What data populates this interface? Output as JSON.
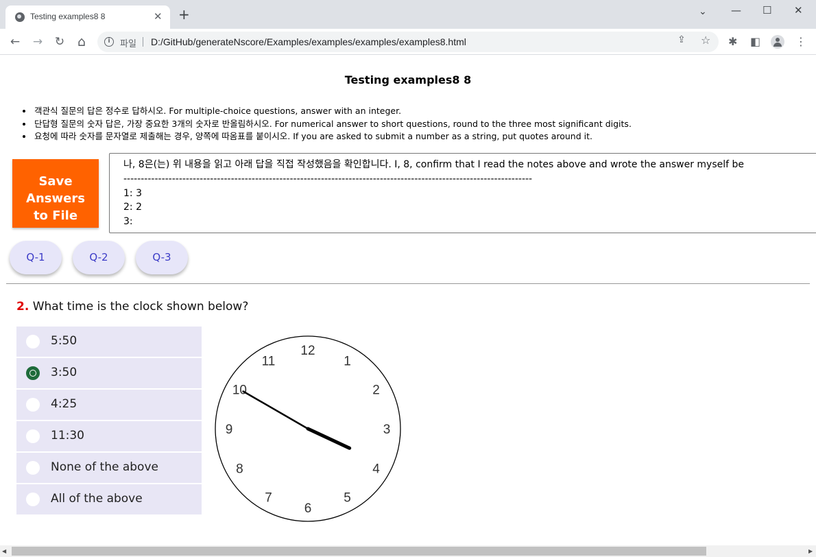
{
  "browser": {
    "tab_title": "Testing examples8 8",
    "tab_close": "✕",
    "new_tab": "+",
    "window_controls": {
      "minimize": "—",
      "maximize": "☐",
      "close": "✕"
    },
    "nav": {
      "back": "←",
      "forward": "→",
      "reload": "↻",
      "home": "⌂"
    },
    "info_glyph": "i",
    "scheme_label": "파일",
    "url": "D:/GitHub/generateNscore/Examples/examples/examples/examples8.html",
    "share_glyph": "⇪",
    "star_glyph": "☆",
    "extensions_glyph": "✱",
    "sidepanel_glyph": "◧",
    "menu_glyph": "⋮"
  },
  "page": {
    "title": "Testing examples8 8",
    "rules": [
      "객관식 질문의 답은 정수로 답하시오. For multiple-choice questions, answer with an integer.",
      "단답형 질문의 숫자 답은, 가장 중요한 3개의 숫자로 반올림하시오. For numerical answer to short questions, round to the three most significant digits.",
      "요청에 따라 숫자를 문자열로 제출해는 경우, 양쪽에 따옴표를 붙이시오. If you are asked to submit a number as a string, put quotes around it."
    ],
    "save_button": {
      "line1": "Save",
      "line2": "Answers",
      "line3": "to File",
      "color": "#ff6200"
    },
    "answers_box": {
      "confirm": "나, 8은(는) 위 내용을 읽고 아래 답을 직접 작성했음을 확인합니다. I, 8, confirm that I read the notes above and wrote the answer myself be",
      "dashes": "----------------------------------------------------------------------------------------------------------------------",
      "line1": "1: 3",
      "line2": "2: 2",
      "line3": "3:"
    },
    "question_nav": [
      "Q-1",
      "Q-2",
      "Q-3"
    ],
    "question": {
      "number": "2.",
      "text": "What time is the clock shown below?",
      "number_color": "#e00000",
      "options": [
        {
          "label": "5:50",
          "selected": false
        },
        {
          "label": "3:50",
          "selected": true
        },
        {
          "label": "4:25",
          "selected": false
        },
        {
          "label": "11:30",
          "selected": false
        },
        {
          "label": "None of the above",
          "selected": false
        },
        {
          "label": "All of the above",
          "selected": false
        }
      ],
      "selected_color": "#1e6b3a"
    },
    "clock": {
      "numbers": [
        "12",
        "1",
        "2",
        "3",
        "4",
        "5",
        "6",
        "7",
        "8",
        "9",
        "10",
        "11"
      ],
      "hour": 3,
      "minute": 50
    }
  }
}
